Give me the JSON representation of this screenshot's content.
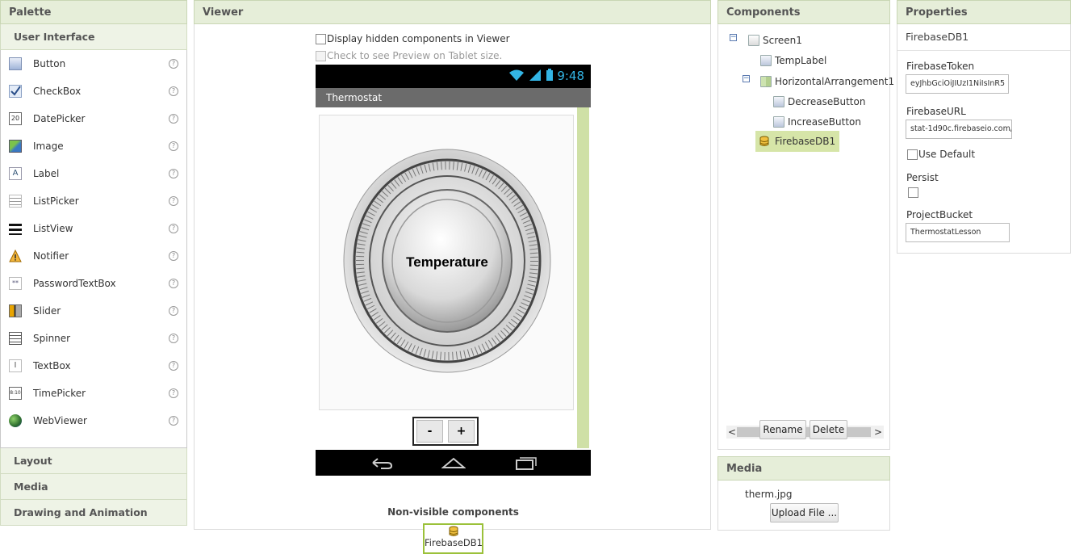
{
  "palette": {
    "title": "Palette",
    "active_section": "User Interface",
    "items": [
      {
        "label": "Button",
        "icon": "button-icon"
      },
      {
        "label": "CheckBox",
        "icon": "checkbox-icon"
      },
      {
        "label": "DatePicker",
        "icon": "datepicker-icon"
      },
      {
        "label": "Image",
        "icon": "image-icon"
      },
      {
        "label": "Label",
        "icon": "label-icon"
      },
      {
        "label": "ListPicker",
        "icon": "listpicker-icon"
      },
      {
        "label": "ListView",
        "icon": "listview-icon"
      },
      {
        "label": "Notifier",
        "icon": "notifier-icon"
      },
      {
        "label": "PasswordTextBox",
        "icon": "password-textbox-icon"
      },
      {
        "label": "Slider",
        "icon": "slider-icon"
      },
      {
        "label": "Spinner",
        "icon": "spinner-icon"
      },
      {
        "label": "TextBox",
        "icon": "textbox-icon"
      },
      {
        "label": "TimePicker",
        "icon": "timepicker-icon"
      },
      {
        "label": "WebViewer",
        "icon": "webviewer-icon"
      }
    ],
    "help_glyph": "?",
    "datepicker_glyph": "20",
    "timepicker_glyph": "8:10",
    "label_glyph": "A",
    "password_glyph": "**",
    "textbox_glyph": "I",
    "collapsed_sections": [
      "Layout",
      "Media",
      "Drawing and Animation"
    ]
  },
  "viewer": {
    "title": "Viewer",
    "show_hidden_label": "Display hidden components in Viewer",
    "tablet_preview_label": "Check to see Preview on Tablet size.",
    "status_time": "9:48",
    "screen_title": "Thermostat",
    "dial_text": "Temperature",
    "decrease_label": "-",
    "increase_label": "+",
    "non_visible_title": "Non-visible components",
    "non_visible_items": [
      "FirebaseDB1"
    ]
  },
  "components": {
    "title": "Components",
    "tree": {
      "screen": "Screen1",
      "temp_label": "TempLabel",
      "arrangement": "HorizontalArrangement1",
      "decrease": "DecreaseButton",
      "increase": "IncreaseButton",
      "firebase": "FirebaseDB1"
    },
    "collapse_glyph": "−",
    "scroll_left": "<",
    "scroll_right": ">",
    "rename_label": "Rename",
    "delete_label": "Delete"
  },
  "media": {
    "title": "Media",
    "files": [
      "therm.jpg"
    ],
    "upload_label": "Upload File ..."
  },
  "properties": {
    "title": "Properties",
    "selected_component": "FirebaseDB1",
    "firebase_token_label": "FirebaseToken",
    "firebase_token_value": "eyJhbGciOiJIUzI1NiIsInR5",
    "firebase_url_label": "FirebaseURL",
    "firebase_url_value": "stat-1d90c.firebaseio.com/",
    "use_default_label": "Use Default",
    "persist_label": "Persist",
    "project_bucket_label": "ProjectBucket",
    "project_bucket_value": "ThermostatLesson"
  },
  "colors": {
    "panel_header_bg": "#e6eed9",
    "selected_bg": "#d6e5a8",
    "accent_green": "#9bc13a",
    "status_blue": "#33b5e5"
  }
}
